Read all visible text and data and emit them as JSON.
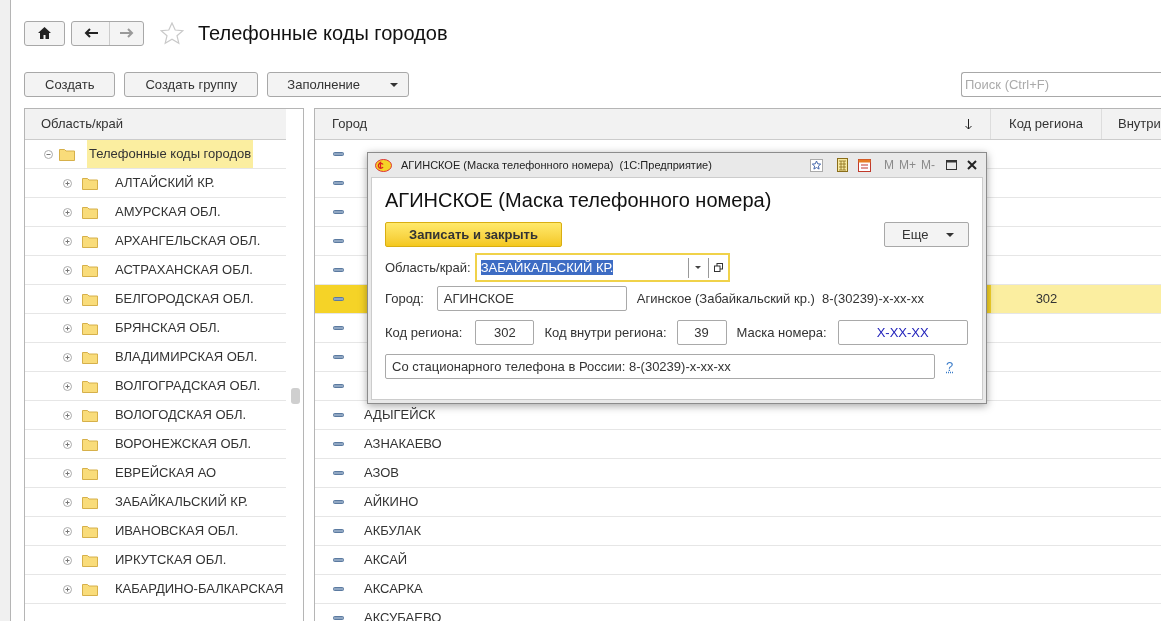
{
  "window": {
    "title": "Телефонные коды городов",
    "favorite": false
  },
  "toolbar": {
    "buttons": [
      {
        "label": "Создать",
        "kind": "plain"
      },
      {
        "label": "Создать группу",
        "kind": "plain"
      },
      {
        "label": "Заполнение",
        "kind": "dropdown"
      }
    ],
    "search": {
      "placeholder": "Поиск (Ctrl+F)"
    }
  },
  "tree": {
    "column": "Область/край",
    "items": [
      {
        "label": "Телефонные коды городов",
        "selected": true,
        "expanded": true,
        "children": [
          {
            "label": "АЛТАЙСКИЙ КР.",
            "selected": false,
            "expanded": false
          },
          {
            "label": "АМУРСКАЯ ОБЛ.",
            "selected": false,
            "expanded": false
          },
          {
            "label": "АРХАНГЕЛЬСКАЯ ОБЛ.",
            "selected": false,
            "expanded": false
          },
          {
            "label": "АСТРАХАНСКАЯ ОБЛ.",
            "selected": false,
            "expanded": false
          },
          {
            "label": "БЕЛГОРОДСКАЯ ОБЛ.",
            "selected": false,
            "expanded": false
          },
          {
            "label": "БРЯНСКАЯ ОБЛ.",
            "selected": false,
            "expanded": false
          },
          {
            "label": "ВЛАДИМИРСКАЯ ОБЛ.",
            "selected": false,
            "expanded": false
          },
          {
            "label": "ВОЛГОГРАДСКАЯ ОБЛ.",
            "selected": false,
            "expanded": false
          },
          {
            "label": "ВОЛОГОДСКАЯ ОБЛ.",
            "selected": false,
            "expanded": false
          },
          {
            "label": "ВОРОНЕЖСКАЯ ОБЛ.",
            "selected": false,
            "expanded": false
          },
          {
            "label": "ЕВРЕЙСКАЯ АО",
            "selected": false,
            "expanded": false
          },
          {
            "label": "ЗАБАЙКАЛЬСКИЙ КР.",
            "selected": false,
            "expanded": false
          },
          {
            "label": "ИВАНОВСКАЯ ОБЛ.",
            "selected": false,
            "expanded": false
          },
          {
            "label": "ИРКУТСКАЯ ОБЛ.",
            "selected": false,
            "expanded": false
          },
          {
            "label": "КАБАРДИНО-БАЛКАРСКАЯ",
            "selected": false,
            "expanded": false
          }
        ]
      }
    ]
  },
  "table": {
    "columns": [
      "Город",
      "Код региона",
      "Внутри"
    ],
    "rows": [
      {
        "selected": false
      },
      {
        "selected": false
      },
      {
        "selected": false
      },
      {
        "selected": false
      },
      {
        "selected": false
      },
      {
        "selected": true,
        "region_code": "302"
      },
      {
        "selected": false
      },
      {
        "selected": false
      },
      {
        "selected": false
      },
      {
        "selected": false,
        "city": "АДЫГЕЙСК"
      },
      {
        "selected": false,
        "city": "АЗНАКАЕВО"
      },
      {
        "selected": false,
        "city": "АЗОВ"
      },
      {
        "selected": false,
        "city": "АЙКИНО"
      },
      {
        "selected": false,
        "city": "АКБУЛАК"
      },
      {
        "selected": false,
        "city": "АКСАЙ"
      },
      {
        "selected": false,
        "city": "АКСАРКА"
      },
      {
        "selected": false,
        "city": "АКСУБАЕВО"
      }
    ]
  },
  "dialog": {
    "title": "АГИНСКОЕ (Маска телефонного номера)  (1С:Предприятие)",
    "heading": "АГИНСКОЕ (Маска телефонного номера)",
    "memory_buttons": [
      "M",
      "M+",
      "M-"
    ],
    "save_button": "Записать и закрыть",
    "more_button": "Еще",
    "region": {
      "label": "Область/край:",
      "value": "ЗАБАЙКАЛЬСКИЙ КР."
    },
    "city": {
      "label": "Город:",
      "value": "АГИНСКОЕ"
    },
    "city_info": "Агинское (Забайкальский кр.)  8-(30239)-х-хх-хх",
    "region_code": {
      "label": "Код региона:",
      "value": "302"
    },
    "inner_code": {
      "label": "Код внутри региона:",
      "value": "39"
    },
    "mask": {
      "label": "Маска номера:",
      "value": "Х-ХХ-ХХ"
    },
    "description": "Со стационарного телефона в России: 8-(30239)-х-хх-хх",
    "help": "?"
  }
}
